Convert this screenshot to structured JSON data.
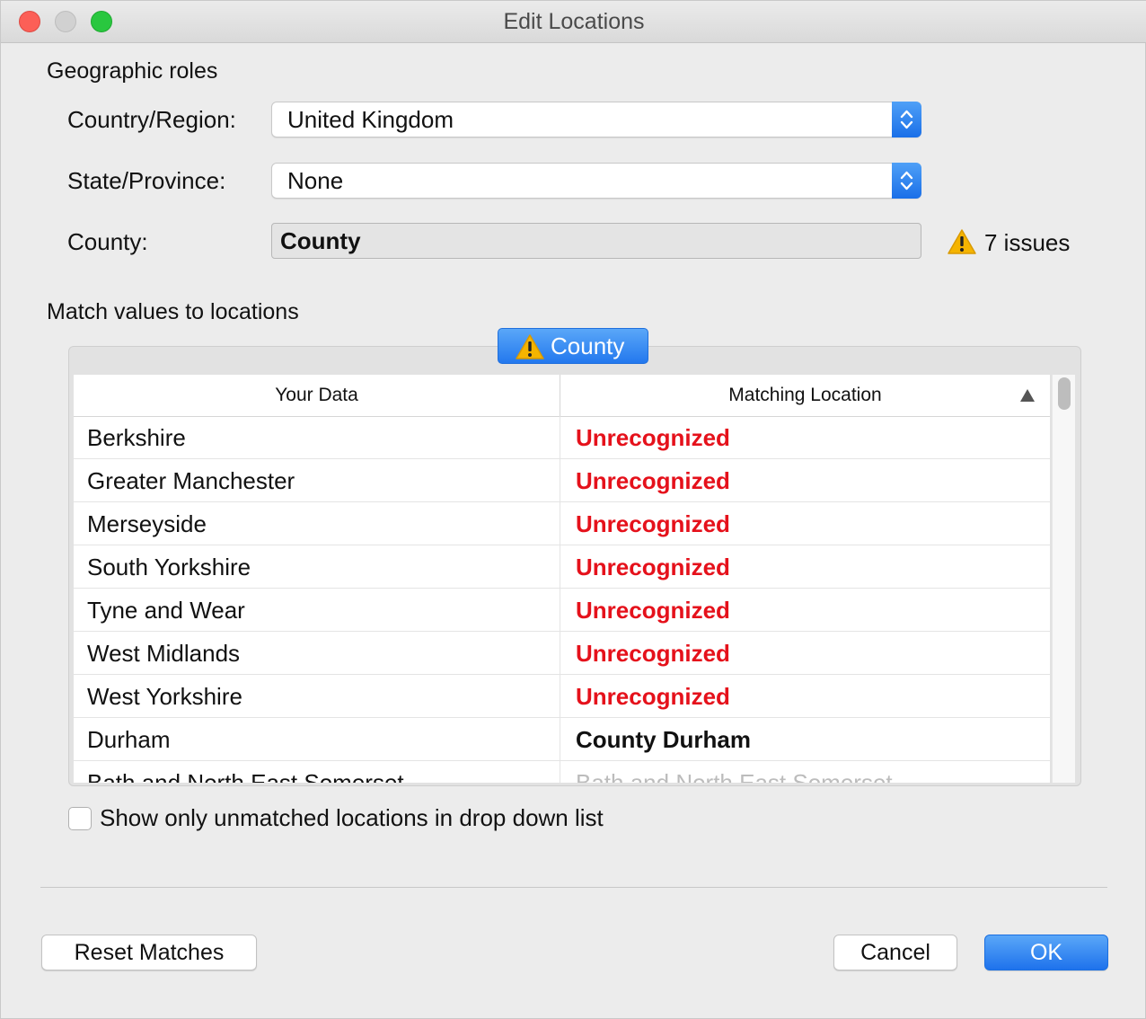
{
  "window": {
    "title": "Edit Locations"
  },
  "geographic_roles": {
    "heading": "Geographic roles",
    "country_label": "Country/Region:",
    "country_value": "United Kingdom",
    "state_label": "State/Province:",
    "state_value": "None",
    "county_label": "County:",
    "county_value": "County",
    "issues_text": "7 issues"
  },
  "match": {
    "heading": "Match values to locations",
    "tab_label": "County",
    "columns": [
      "Your Data",
      "Matching Location"
    ],
    "sort": "ascending",
    "rows": [
      {
        "data": "Berkshire",
        "match": "Unrecognized",
        "status": "unrecognized"
      },
      {
        "data": "Greater Manchester",
        "match": "Unrecognized",
        "status": "unrecognized"
      },
      {
        "data": "Merseyside",
        "match": "Unrecognized",
        "status": "unrecognized"
      },
      {
        "data": "South Yorkshire",
        "match": "Unrecognized",
        "status": "unrecognized"
      },
      {
        "data": "Tyne and Wear",
        "match": "Unrecognized",
        "status": "unrecognized"
      },
      {
        "data": "West Midlands",
        "match": "Unrecognized",
        "status": "unrecognized"
      },
      {
        "data": "West Yorkshire",
        "match": "Unrecognized",
        "status": "unrecognized"
      },
      {
        "data": "Durham",
        "match": "County Durham",
        "status": "matched"
      },
      {
        "data": "Bath and North East Somerset",
        "match": "Bath and North East Somerset",
        "status": "auto"
      }
    ]
  },
  "options": {
    "show_unmatched_label": "Show only unmatched locations in drop down list",
    "show_unmatched_checked": false
  },
  "buttons": {
    "reset": "Reset Matches",
    "cancel": "Cancel",
    "ok": "OK"
  },
  "colors": {
    "accent": "#2378ee",
    "error": "#e5111b",
    "warning": "#f5b400"
  },
  "icons": {
    "warning": "warning-icon",
    "stepper": "up-down-chevron-icon",
    "sort": "sort-ascending-icon"
  }
}
